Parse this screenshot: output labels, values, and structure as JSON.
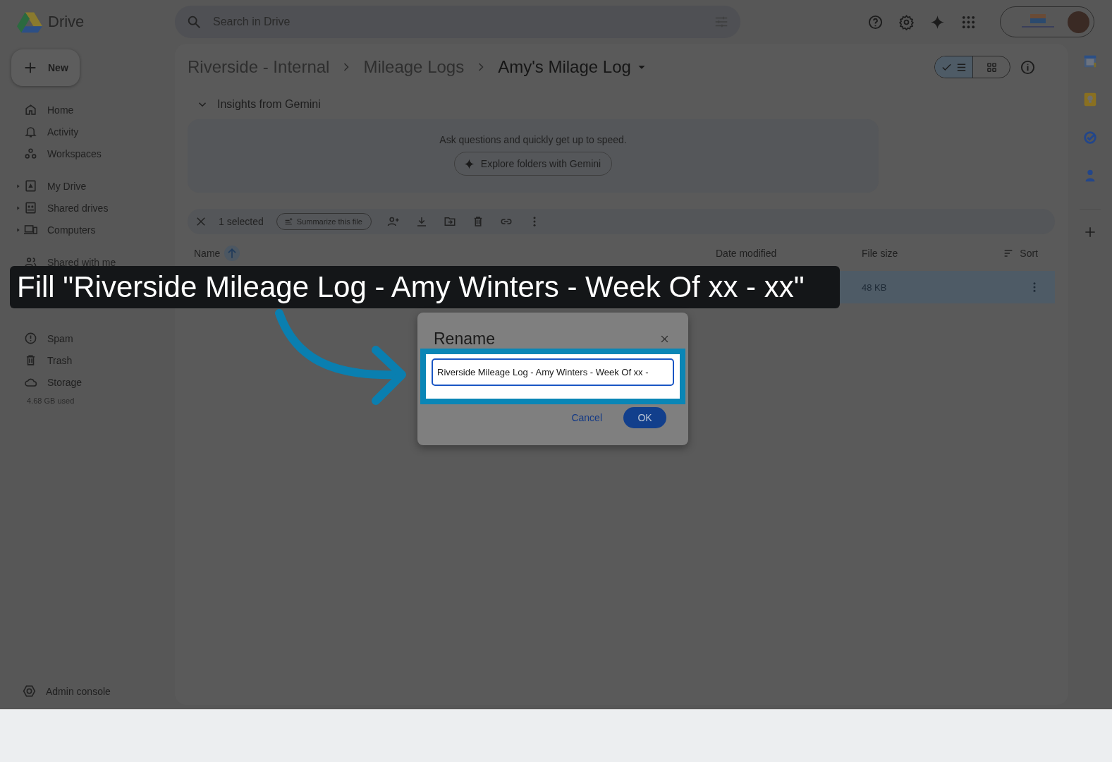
{
  "app": {
    "name": "Drive"
  },
  "search": {
    "placeholder": "Search in Drive"
  },
  "new_button": {
    "label": "New"
  },
  "sidebar": {
    "sections": [
      [
        {
          "label": "Home"
        },
        {
          "label": "Activity"
        },
        {
          "label": "Workspaces"
        }
      ],
      [
        {
          "label": "My Drive",
          "expanded": false
        },
        {
          "label": "Shared drives",
          "expanded": false
        },
        {
          "label": "Computers",
          "expanded": false
        }
      ],
      [
        {
          "label": "Shared with me"
        }
      ],
      [
        {
          "label": "Spam"
        },
        {
          "label": "Trash"
        },
        {
          "label": "Storage"
        }
      ]
    ],
    "storage_used": "4.68 GB used",
    "admin": {
      "label": "Admin console"
    }
  },
  "breadcrumbs": [
    {
      "label": "Riverside - Internal",
      "current": false
    },
    {
      "label": "Mileage Logs",
      "current": false
    },
    {
      "label": "Amy's Milage Log",
      "current": true
    }
  ],
  "view_toggle": [
    {
      "kind": "list",
      "selected": true
    },
    {
      "kind": "grid",
      "selected": false
    }
  ],
  "gemini": {
    "title": "Insights from Gemini",
    "expanded": true,
    "text": "Ask questions and quickly get up to speed.",
    "button": "Explore folders with Gemini"
  },
  "selection_bar": {
    "count": "1 selected",
    "summarize": "Summarize this file"
  },
  "table": {
    "columns": [
      {
        "label": "Name",
        "sorted": true
      },
      {
        "label": "Date modified",
        "sorted": false
      },
      {
        "label": "File size",
        "sorted": false
      }
    ],
    "sort_button": "Sort",
    "rows": [
      {
        "file_size": "48 KB",
        "selected": true
      }
    ]
  },
  "callout": {
    "text": "Fill \"Riverside Mileage Log - Amy Winters - Week Of xx - xx\""
  },
  "dialog": {
    "title": "Rename",
    "value": "Riverside Mileage Log - Amy Winters - Week Of xx -",
    "buttons": [
      {
        "label": "Cancel",
        "kind": "text"
      },
      {
        "label": "OK",
        "kind": "primary"
      }
    ]
  }
}
